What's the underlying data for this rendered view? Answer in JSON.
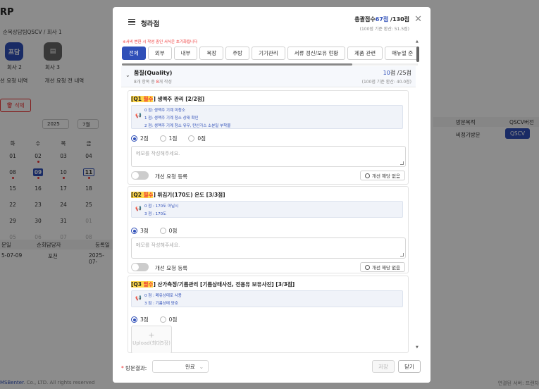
{
  "background": {
    "brand": "RP",
    "breadcrumb": "순목상담팀QSCV / 회사 1",
    "stores": [
      {
        "badge": "프담",
        "label": "회사 2"
      },
      {
        "badge": "",
        "label": "회사 3"
      }
    ],
    "links": [
      "선 요청 내역",
      "개선 요청 전 내역"
    ],
    "delete_label": "삭제",
    "year_select": "2025",
    "month_select": "7월",
    "calendar": {
      "weekdays": [
        "화",
        "수",
        "목",
        "금"
      ],
      "rows": [
        [
          "01",
          "02",
          "03",
          "04"
        ],
        [
          "08",
          "09",
          "10",
          "11"
        ],
        [
          "15",
          "16",
          "17",
          "18"
        ],
        [
          "22",
          "23",
          "24",
          "25"
        ],
        [
          "29",
          "30",
          "31",
          "01"
        ],
        [
          "05",
          "06",
          "07",
          "08"
        ]
      ]
    },
    "table_headers": [
      "문일",
      "순회담당자",
      "등록일"
    ],
    "table_row": [
      "5-07-09",
      "포천",
      "2025-07-"
    ],
    "right_headers": [
      "방문목적",
      "QSCV버전"
    ],
    "right_row": [
      "비정기방문",
      "QSCV"
    ],
    "footer_left_brand": "MSBenter",
    "footer_left": ". Co., LTD. All rights reserved",
    "footer_right": "연결된 서버: 프랜차"
  },
  "modal": {
    "title": "청라점",
    "total_label": "총괄점수",
    "total_score": "67점",
    "total_max": "/130점",
    "converted": "(100점 기준 환산: 51.5점)",
    "note": "※서비 변환 시 작성 중인 서식은 초기화됩니다",
    "tabs": [
      "전체",
      "외부",
      "내부",
      "복장",
      "주방",
      "기기관리",
      "서류 갱신/보유 현황",
      "제품 관련",
      "매뉴얼 준"
    ],
    "active_tab": 0,
    "section": {
      "name": "품질(Quality)",
      "progress_prefix": "8개 항목 중 ",
      "progress_count": "8",
      "progress_suffix": "개 작성",
      "score": "10",
      "max": "점 /25점",
      "converted": "(100점 기준 환산: 40.0점)"
    },
    "questions": [
      {
        "prefix": "[Q1",
        "required": "필수",
        "title": "] 생맥주 관리 [2/2점]",
        "criteria": [
          "0 점: 생맥주 기계 미청소",
          "1 점: 생맥주 기계 청소 상태 확인",
          "2 점: 생맥주 기계 청소 유무, 탄산가스 소분일 부착물"
        ],
        "options": [
          "2점",
          "1점",
          "0점"
        ],
        "selected": 0,
        "memo_placeholder": "메모를 작성해주세요.",
        "toggle_label": "개선 요청 등록",
        "na_label": "개선 해당 없음"
      },
      {
        "prefix": "[Q2",
        "required": "필수",
        "title": "] 튀김기(170도) 온도 [3/3점]",
        "criteria": [
          "0 점 : 170도 아닐시",
          "3 점 : 170도"
        ],
        "options": [
          "3점",
          "0점"
        ],
        "selected": 0,
        "memo_placeholder": "메모를 작성해주세요.",
        "toggle_label": "개선 요청 등록",
        "na_label": "개선 해당 없음"
      },
      {
        "prefix": "[Q3",
        "required": "필수",
        "title": "] 산가측정/기름관리 [기름상태사진, 전용유 보유사진] [3/3점]",
        "criteria": [
          "0 점 : 폐유상태로 사용",
          "3 점 : 기름상태 양호"
        ],
        "options": [
          "3점",
          "0점"
        ],
        "selected": 0,
        "upload_label": "Upload(최대5장)"
      }
    ],
    "footer": {
      "result_label": "방문결과:",
      "result_value": "완료",
      "save_label": "저장",
      "close_label": "닫기"
    }
  }
}
